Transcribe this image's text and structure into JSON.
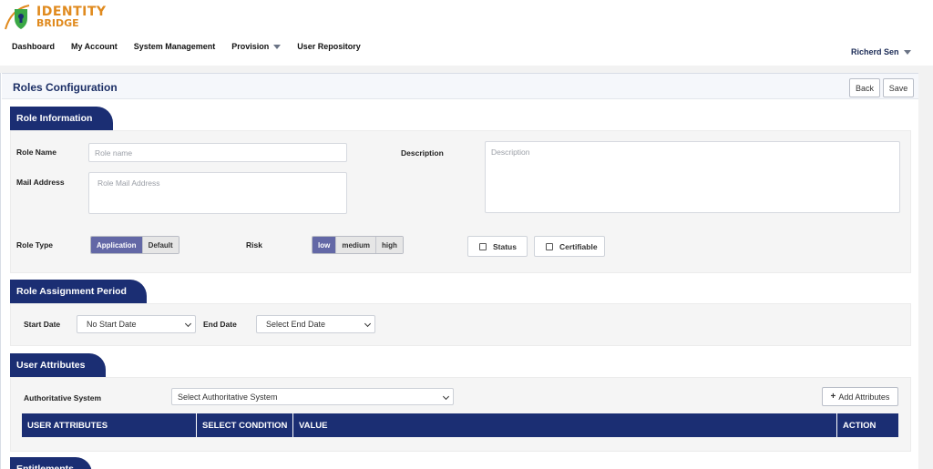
{
  "brand": {
    "line1": "IDENTITY",
    "line2": "BRIDGE"
  },
  "nav": {
    "items": [
      {
        "label": "Dashboard"
      },
      {
        "label": "My Account"
      },
      {
        "label": "System Management"
      },
      {
        "label": "Provision"
      },
      {
        "label": "User Repository"
      }
    ],
    "user": "Richerd Sen"
  },
  "page": {
    "title": "Roles Configuration",
    "back_label": "Back",
    "save_label": "Save"
  },
  "role_info": {
    "section_title": "Role Information",
    "role_name_label": "Role Name",
    "role_name_placeholder": "Role name",
    "description_label": "Description",
    "description_placeholder": "Description",
    "mail_label": "Mail Address",
    "mail_placeholder": "Role Mail Address",
    "role_type_label": "Role Type",
    "role_type_options": [
      "Application",
      "Default"
    ],
    "role_type_selected": "Application",
    "risk_label": "Risk",
    "risk_options": [
      "low",
      "medium",
      "high"
    ],
    "risk_selected": "low",
    "status_label": "Status",
    "certifiable_label": "Certifiable"
  },
  "assignment": {
    "section_title": "Role Assignment Period",
    "start_label": "Start Date",
    "start_value": "No Start Date",
    "end_label": "End Date",
    "end_value": "Select End Date"
  },
  "attributes": {
    "section_title": "User Attributes",
    "auth_label": "Authoritative System",
    "auth_value": "Select Authoritative System",
    "add_label": "Add Attributes",
    "columns": [
      "USER ATTRIBUTES",
      "SELECT CONDITION",
      "VALUE",
      "ACTION"
    ]
  },
  "entitlements": {
    "section_title": "Entitlements"
  },
  "colors": {
    "navy": "#1b2e73",
    "segment_active": "#6368a6",
    "brand_orange": "#e08a1e"
  }
}
